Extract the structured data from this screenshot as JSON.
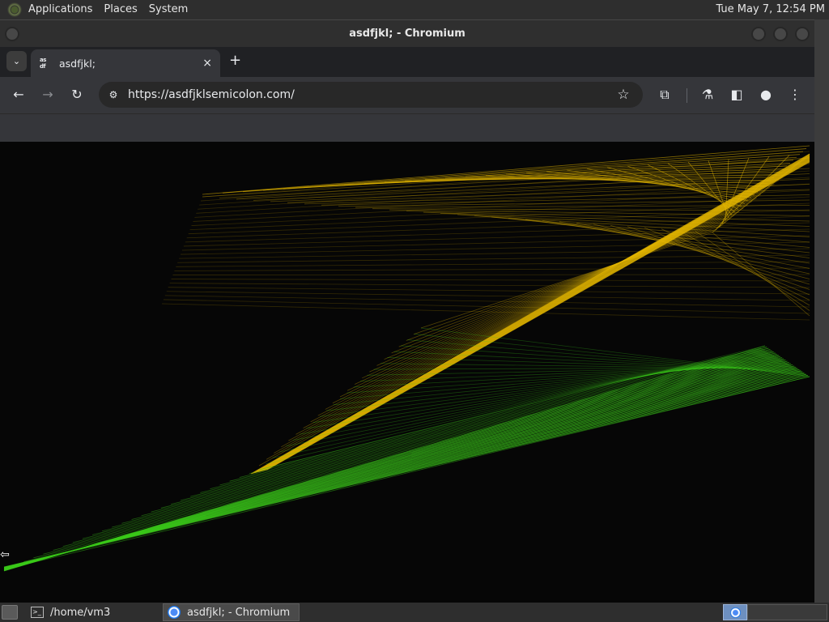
{
  "top_panel": {
    "menus": [
      "Applications",
      "Places",
      "System"
    ],
    "clock": "Tue May  7, 12:54 PM"
  },
  "window": {
    "title": "asdfjkl; - Chromium"
  },
  "browser": {
    "tab": {
      "favicon_text_top": "as",
      "favicon_text_bottom": "df",
      "title": "asdfjkl;",
      "close_icon": "×"
    },
    "tab_search_icon": "⌄",
    "new_tab_icon": "+",
    "toolbar": {
      "back_icon": "←",
      "forward_icon": "→",
      "reload_icon": "↻",
      "site_info_icon": "⚙",
      "url": "https://asdfjklsemicolon.com/",
      "star_icon": "☆",
      "extensions_icon": "⧉",
      "labs_icon": "⚗",
      "sidepanel_icon": "◧",
      "profile_icon": "●",
      "menu_icon": "⋮"
    }
  },
  "content": {
    "colors": {
      "background": "#060606",
      "yellow": "#e6b800",
      "green": "#3ccc1a"
    }
  },
  "taskbar": {
    "items": [
      {
        "label": "/home/vm3",
        "icon": "terminal-icon"
      },
      {
        "label": "asdfjkl; - Chromium",
        "icon": "chromium-icon"
      }
    ]
  }
}
